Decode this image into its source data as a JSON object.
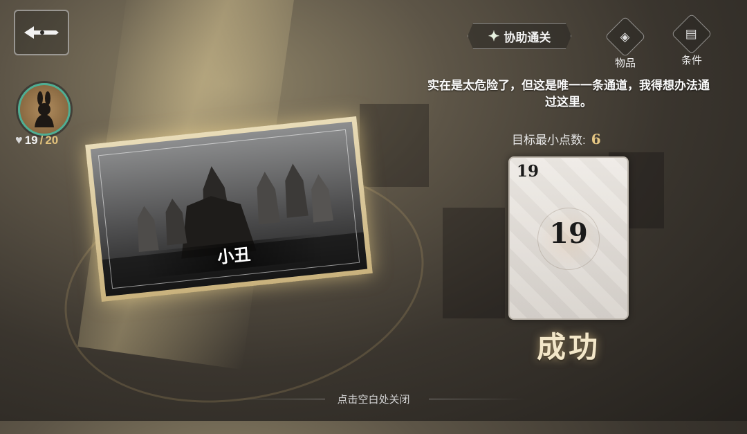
{
  "header": {
    "back_icon": "back-arrow-icon"
  },
  "player": {
    "avatar_icon": "rabbit-silhouette-icon",
    "hp_current": "19",
    "hp_separator": "/",
    "hp_max": "20",
    "heart_icon": "heart-icon"
  },
  "event_card": {
    "name": "小丑"
  },
  "coop": {
    "label": "协助通关",
    "icon": "sparkle-icon"
  },
  "actions": {
    "items_label": "物品",
    "items_icon": "item-diamond-icon",
    "conditions_label": "条件",
    "conditions_icon": "document-icon"
  },
  "description": "实在是太危险了，但这是唯一一条通道，我得想办法通过这里。",
  "target": {
    "label": "目标最小点数:",
    "value": "6"
  },
  "roll_card": {
    "corner_value": "19",
    "center_value": "19"
  },
  "result": "成功",
  "footer": {
    "close_hint": "点击空白处关闭"
  },
  "colors": {
    "accent_gold": "#e6c784",
    "hp_ring": "#4fae93"
  }
}
